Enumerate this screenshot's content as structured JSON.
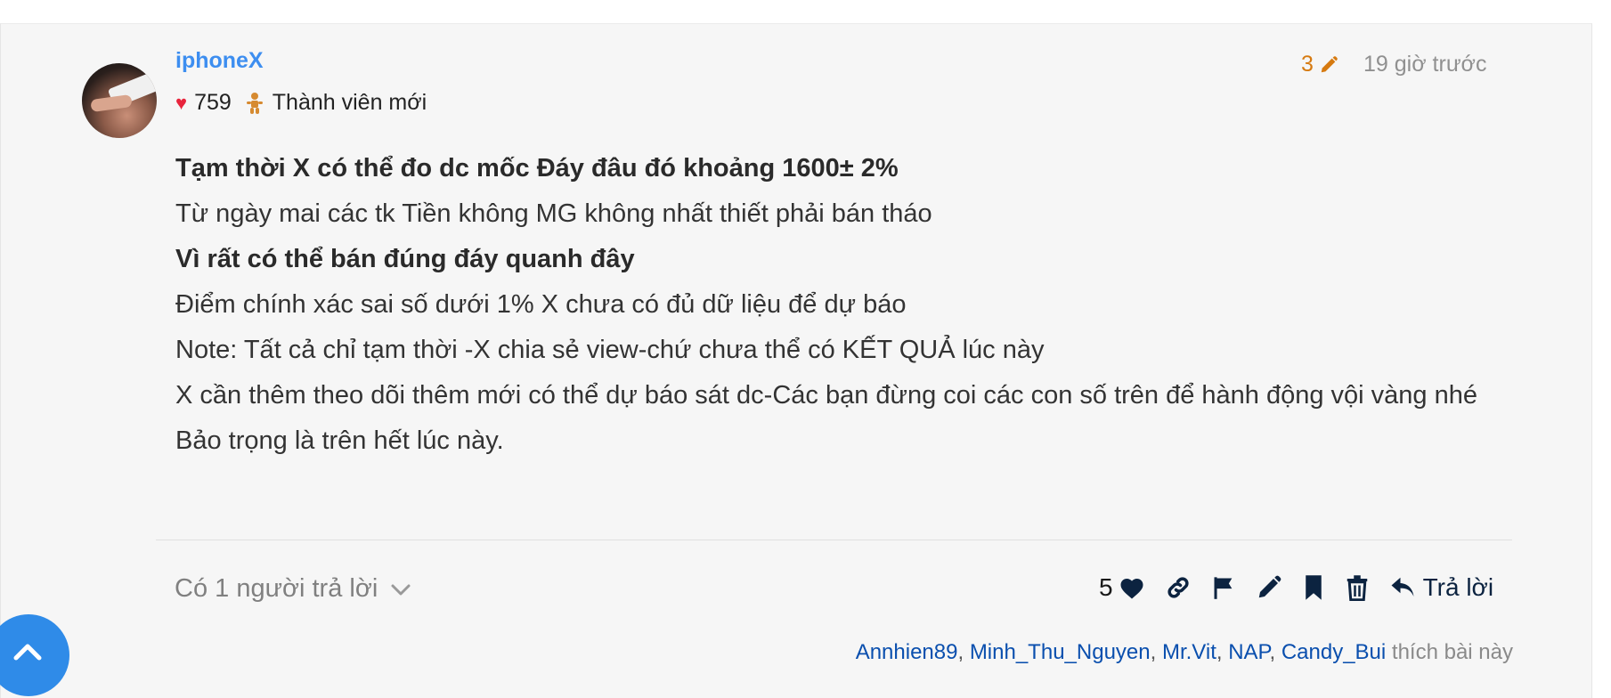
{
  "post": {
    "username": "iphoneX",
    "likes_total": "759",
    "member_rank": "Thành viên mới",
    "edit_count": "3",
    "timestamp": "19 giờ trước",
    "content": [
      "Tạm thời X có thể đo dc mốc Đáy đâu đó khoảng 1600± 2%",
      "Từ ngày mai các tk Tiền không MG không nhất thiết phải bán tháo",
      "Vì rất có thể bán đúng đáy quanh đây",
      "Điểm chính xác sai số dưới 1% X chưa có đủ dữ liệu để dự báo",
      "Note: Tất cả chỉ tạm thời -X chia sẻ view-chứ chưa thể có KẾT QUẢ lúc này",
      "X cần thêm theo dõi thêm mới có thể dự báo sát dc-Các bạn đừng coi các con số trên để hành động vội vàng nhé",
      "Bảo trọng là trên hết lúc này."
    ]
  },
  "footer": {
    "replies_label": "Có 1 người trả lời",
    "like_count": "5",
    "reply_label": "Trả lời",
    "likers": [
      "Annhien89",
      "Minh_Thu_Nguyen",
      "Mr.Vit",
      "NAP",
      "Candy_Bui"
    ],
    "likers_suffix": "thích bài này"
  },
  "icons": {
    "heart": "heart-icon",
    "rank": "baby-icon",
    "edit": "pencil-icon",
    "chevron": "chevron-down-icon",
    "link": "link-icon",
    "flag": "flag-icon",
    "bookmark": "bookmark-icon",
    "delete": "trash-icon",
    "reply": "reply-icon",
    "scroll_top": "chevron-up-icon"
  },
  "colors": {
    "username": "#3d8ef0",
    "heart": "#e8243c",
    "edit_count": "#d67a10",
    "action_icons": "#0c2340",
    "liker_links": "#0a4fae",
    "scroll_top_button": "#2f8be8"
  }
}
